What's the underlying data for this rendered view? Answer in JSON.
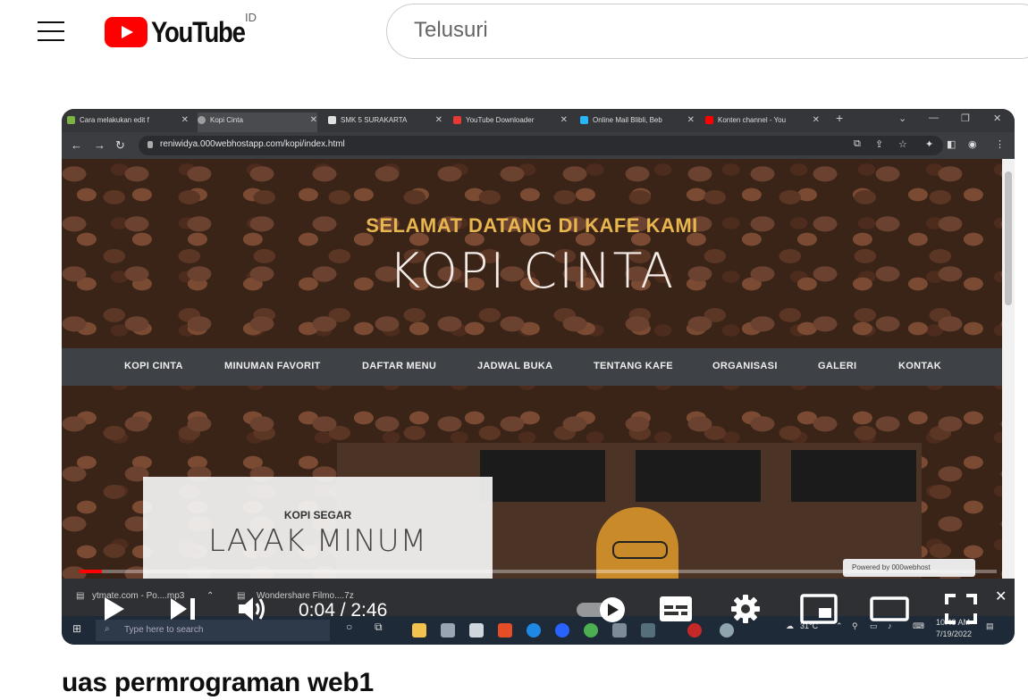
{
  "masthead": {
    "logo_text": "YouTube",
    "country_code": "ID",
    "search_placeholder": "Telusuri"
  },
  "browser": {
    "tabs": [
      {
        "label": "Cara melakukan edit f",
        "color": "#7cb342"
      },
      {
        "label": "Kopi Cinta",
        "color": "#9e9e9e"
      },
      {
        "label": "SMK 5 SURAKARTA",
        "color": "#e0e0e0"
      },
      {
        "label": "YouTube Downloader",
        "color": "#e53935"
      },
      {
        "label": "Online Mail Blibli, Beb",
        "color": "#29b6f6"
      },
      {
        "label": "Konten channel - You",
        "color": "#ff0000"
      }
    ],
    "url": "reniwidya.000webhostapp.com/kopi/index.html"
  },
  "site": {
    "welcome": "SELAMAT DATANG DI KAFE KAMI",
    "brand": "KOPI CINTA",
    "nav": [
      "KOPI CINTA",
      "MINUMAN FAVORIT",
      "DAFTAR MENU",
      "JADWAL BUKA",
      "TENTANG KAFE",
      "ORGANISASI",
      "GALERI",
      "KONTAK"
    ],
    "card_subtitle": "KOPI SEGAR",
    "card_title": "LAYAK MINUM",
    "powered_by": "Powered by  000webhost"
  },
  "downloads": [
    {
      "label": "ytmate.com - Po....mp3"
    },
    {
      "label": "Wondershare Filmo....7z"
    }
  ],
  "taskbar": {
    "search_placeholder": "Type here to search",
    "weather": "31°C",
    "time": "10:49 AM",
    "date": "7/19/2022"
  },
  "player": {
    "current_time": "0:04",
    "duration": "2:46",
    "time_display": "0:04 / 2:46",
    "progress_fraction": 0.024,
    "controls": {
      "play": "play-icon",
      "next": "next-icon",
      "volume": "volume-icon",
      "autoplay": "autoplay-toggle-icon",
      "subtitles": "subtitles-icon",
      "settings": "settings-icon",
      "miniplayer": "miniplayer-icon",
      "theater": "theater-icon",
      "fullscreen": "fullscreen-icon"
    }
  },
  "video": {
    "title": "uas permrograman web1"
  }
}
